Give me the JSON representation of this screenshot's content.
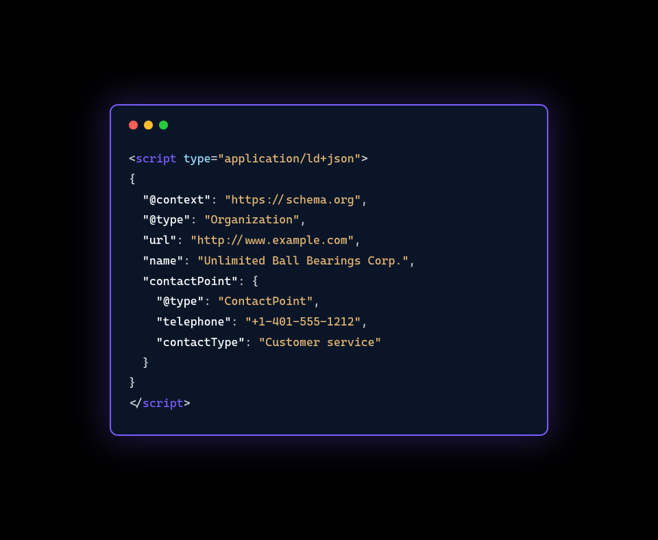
{
  "dots": {
    "red": "#ff5f56",
    "yellow": "#ffbd2e",
    "green": "#27c93f"
  },
  "code": {
    "l1": {
      "open": "<",
      "tag": "script",
      "attrName": "type",
      "eq": "=",
      "attrValue": "\"application/ld+json\"",
      "close": ">"
    },
    "l2": "{",
    "l3": {
      "indent": "  ",
      "key": "\"@context\"",
      "colon": ": ",
      "value": "\"https://schema.org\"",
      "comma": ","
    },
    "l4": {
      "indent": "  ",
      "key": "\"@type\"",
      "colon": ": ",
      "value": "\"Organization\"",
      "comma": ","
    },
    "l5": {
      "indent": "  ",
      "key": "\"url\"",
      "colon": ": ",
      "value": "\"http://www.example.com\"",
      "comma": ","
    },
    "l6": {
      "indent": "  ",
      "key": "\"name\"",
      "colon": ": ",
      "value": "\"Unlimited Ball Bearings Corp.\"",
      "comma": ","
    },
    "l7": {
      "indent": "  ",
      "key": "\"contactPoint\"",
      "colon": ": ",
      "brace": "{"
    },
    "l8": {
      "indent": "    ",
      "key": "\"@type\"",
      "colon": ": ",
      "value": "\"ContactPoint\"",
      "comma": ","
    },
    "l9": {
      "indent": "    ",
      "key": "\"telephone\"",
      "colon": ": ",
      "value": "\"+1-401-555-1212\"",
      "comma": ","
    },
    "l10": {
      "indent": "    ",
      "key": "\"contactType\"",
      "colon": ": ",
      "value": "\"Customer service\""
    },
    "l11": {
      "indent": "  ",
      "brace": "}"
    },
    "l12": "}",
    "l13": {
      "open": "</",
      "tag": "script",
      "close": ">"
    }
  }
}
